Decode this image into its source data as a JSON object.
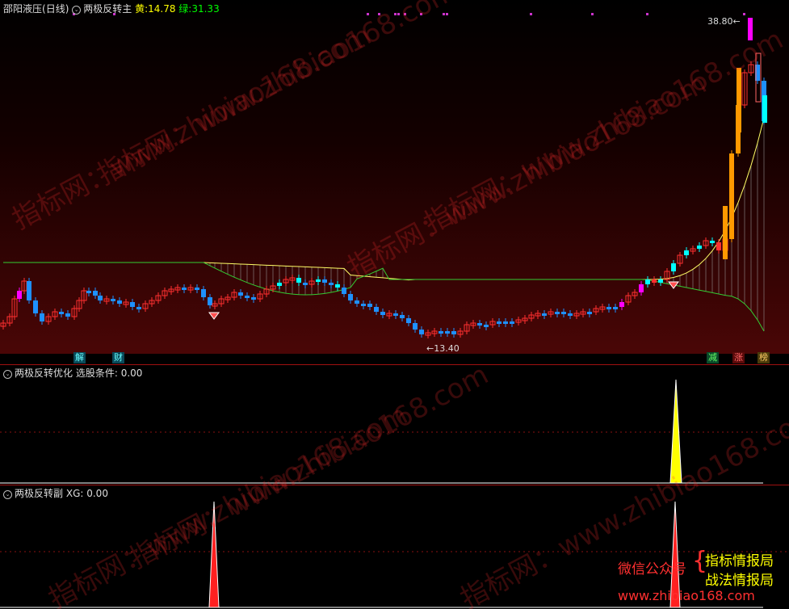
{
  "main": {
    "stock_name": "邵阳液压",
    "period": "(日线)",
    "indicator": "两极反转主",
    "yellow_label": "黄:",
    "yellow_value": "14.78",
    "green_label": "绿:",
    "green_value": "31.33",
    "high_label": "38.80",
    "low_label": "13.40",
    "tags": [
      {
        "text": "解",
        "bg": "#0a4a5a",
        "color": "#6ff"
      },
      {
        "text": "财",
        "bg": "#0a4a5a",
        "color": "#6ff"
      },
      {
        "text": "减",
        "bg": "#0a4a2a",
        "color": "#6f6"
      },
      {
        "text": "涨",
        "bg": "#5a0a0a",
        "color": "#f66"
      },
      {
        "text": "榜",
        "bg": "#4a3a0a",
        "color": "#fc6"
      }
    ]
  },
  "sub1": {
    "indicator": "两极反转优化",
    "label": "选股条件:",
    "value": "0.00"
  },
  "sub2": {
    "indicator": "两极反转副",
    "label": "XG:",
    "value": "0.00"
  },
  "watermark": {
    "text": "指标网：www.zhibiao168.com"
  },
  "promo": {
    "wechat": "微信公众号",
    "line1": "指标情报局",
    "line2": "战法情报局",
    "url": "www.zhibiao168.com"
  },
  "colors": {
    "up_candle": "#ff3030",
    "down_candle": "#1e90ff",
    "cyan_candle": "#00ffff",
    "magenta_candle": "#ff00ff",
    "band_yellow": "#ffff66",
    "band_green": "#33cc33",
    "signal_yellow": "#ffff00",
    "signal_red": "#ff2020"
  }
}
